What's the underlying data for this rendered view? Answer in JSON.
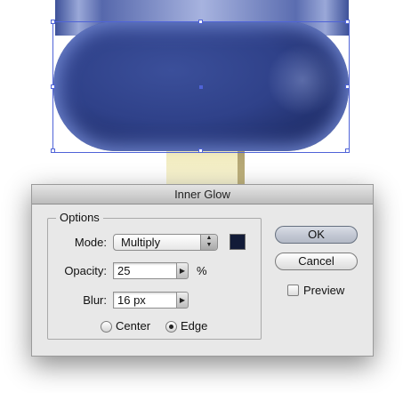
{
  "dialog": {
    "title": "Inner Glow",
    "group_title": "Options",
    "mode": {
      "label": "Mode:",
      "value": "Multiply",
      "arrows_icon": "▲\n▼",
      "swatch_color": "#121b38"
    },
    "opacity": {
      "label": "Opacity:",
      "value": "25",
      "unit": "%",
      "stepper_icon": "▶"
    },
    "blur": {
      "label": "Blur:",
      "value": "16 px",
      "stepper_icon": "▶"
    },
    "radios": [
      {
        "label": "Center",
        "checked": false
      },
      {
        "label": "Edge",
        "checked": true
      }
    ],
    "buttons": {
      "ok": "OK",
      "cancel": "Cancel"
    },
    "preview": {
      "label": "Preview",
      "checked": false
    }
  },
  "artwork": {
    "shape_fill": "#2f4189",
    "glow_color": "#6f85d0",
    "stick_color": "#f1ebbf",
    "selection_color": "#4f63d8"
  }
}
